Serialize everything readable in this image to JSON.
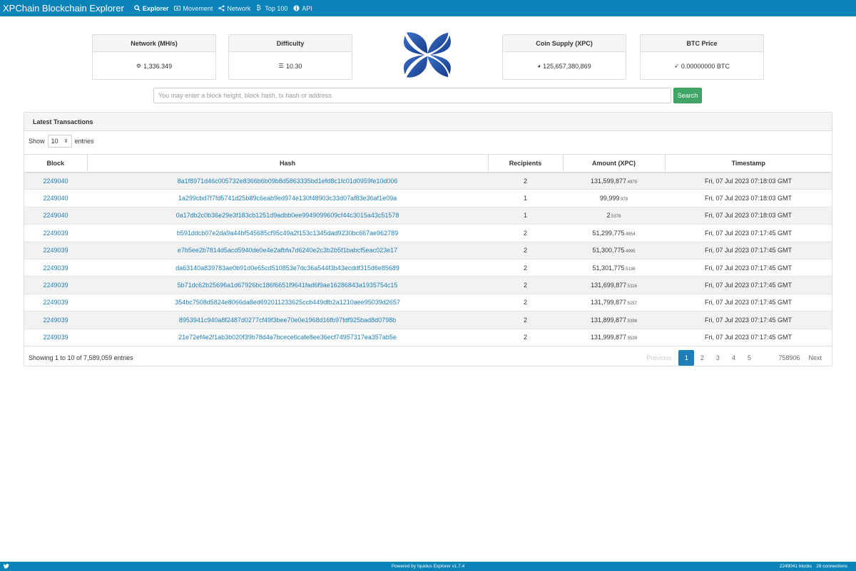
{
  "nav": {
    "brand": "XPChain Blockchain Explorer",
    "items": [
      {
        "label": "Explorer",
        "icon": "search-icon",
        "active": true
      },
      {
        "label": "Movement",
        "icon": "money-icon",
        "active": false
      },
      {
        "label": "Network",
        "icon": "share-icon",
        "active": false
      },
      {
        "label": "Top 100",
        "icon": "bitcoin-icon",
        "active": false
      },
      {
        "label": "API",
        "icon": "info-icon",
        "active": false
      }
    ]
  },
  "stats": {
    "network": {
      "title": "Network (MH/s)",
      "value": "1,336.349",
      "icon": "cogs-icon"
    },
    "difficulty": {
      "title": "Difficulty",
      "value": "10.30",
      "icon": "sliders-icon"
    },
    "supply": {
      "title": "Coin Supply (XPC)",
      "value": "125,657,380,869",
      "icon": "pie-chart-icon"
    },
    "price": {
      "title": "BTC Price",
      "value": "0.00000000 BTC",
      "icon": "rocket-icon"
    }
  },
  "search": {
    "placeholder": "You may enter a block height, block hash, tx hash or address.",
    "button": "Search"
  },
  "transactions": {
    "title": "Latest Transactions",
    "show_label": "Show",
    "entries_value": "10",
    "entries_label": "entries",
    "columns": [
      "Block",
      "Hash",
      "Recipients",
      "Amount (XPC)",
      "Timestamp"
    ],
    "rows": [
      {
        "block": "2249040",
        "hash": "8a1f8971d46c005732e8366b6b09b8d5863335bd1efd8c1fc01d0959fe10d006",
        "recipients": "2",
        "amount": "131,599,877",
        "decimals": ".4975",
        "timestamp": "Fri, 07 Jul 2023 07:18:03 GMT"
      },
      {
        "block": "2249040",
        "hash": "1a299cbd7f7fd5741d25b89c6eab9ed974e130f48903c33d07af83e36af1e09a",
        "recipients": "1",
        "amount": "99,999",
        "decimals": ".978",
        "timestamp": "Fri, 07 Jul 2023 07:18:03 GMT"
      },
      {
        "block": "2249040",
        "hash": "0a17db2c0b36e29e3f183cb1251d9adbb0ee9949099609cf44c3015a43c51578",
        "recipients": "1",
        "amount": "2",
        "decimals": ".5378",
        "timestamp": "Fri, 07 Jul 2023 07:18:03 GMT"
      },
      {
        "block": "2249039",
        "hash": "b591ddcb07e2da9a44bf545685cf95c49a2f153c1345dad9230bc667ae962789",
        "recipients": "2",
        "amount": "51,299,775",
        "decimals": ".4854",
        "timestamp": "Fri, 07 Jul 2023 07:17:45 GMT"
      },
      {
        "block": "2249039",
        "hash": "e7b5ee2b7814d5acd5940de0e4e2afbfa7d6240e2c3b2b5f1babcf5eac023e17",
        "recipients": "2",
        "amount": "51,300,775",
        "decimals": ".4995",
        "timestamp": "Fri, 07 Jul 2023 07:17:45 GMT"
      },
      {
        "block": "2249039",
        "hash": "da63140a839783ae0b91d0e65cd510853e7dc36a544f3b43ecddf315d6e85689",
        "recipients": "2",
        "amount": "51,301,775",
        "decimals": ".5136",
        "timestamp": "Fri, 07 Jul 2023 07:17:45 GMT"
      },
      {
        "block": "2249039",
        "hash": "5b71dc62b25696a1d67926bc186f6651f9641fad6f9ae16286843a1935754c15",
        "recipients": "2",
        "amount": "131,699,877",
        "decimals": ".5116",
        "timestamp": "Fri, 07 Jul 2023 07:17:45 GMT"
      },
      {
        "block": "2249039",
        "hash": "354bc7508d5824e8066da8ed692011233625ccb449dfb2a1210aee95039d2657",
        "recipients": "2",
        "amount": "131,799,877",
        "decimals": ".5257",
        "timestamp": "Fri, 07 Jul 2023 07:17:45 GMT"
      },
      {
        "block": "2249039",
        "hash": "8953941c940a8f2487d0277cf49f3bee70e0e1968d16fb97fdf925bad8d0798b",
        "recipients": "2",
        "amount": "131,899,877",
        "decimals": ".5398",
        "timestamp": "Fri, 07 Jul 2023 07:17:45 GMT"
      },
      {
        "block": "2249039",
        "hash": "21e72ef4e2f1ab3b020f39b78d4a7bcece6cafe8ee36ecf74957317ea357ab5e",
        "recipients": "2",
        "amount": "131,999,877",
        "decimals": ".5539",
        "timestamp": "Fri, 07 Jul 2023 07:17:45 GMT"
      }
    ],
    "info": "Showing 1 to 10 of 7,589,059 entries",
    "pagination": {
      "previous": "Previous",
      "pages": [
        "1",
        "2",
        "3",
        "4",
        "5"
      ],
      "current": "1",
      "ellipsis": "…",
      "last": "758906",
      "next": "Next"
    }
  },
  "footer": {
    "powered": "Powered by Iquidus Explorer v1.7.4",
    "blocks": "2249041 blocks",
    "connections": "28 connections",
    "icon": "twitter-icon"
  },
  "colors": {
    "brand": "#0a83b8",
    "link": "#1d7eb8",
    "search_button": "#40a668",
    "logo": "#1f4fa3"
  }
}
